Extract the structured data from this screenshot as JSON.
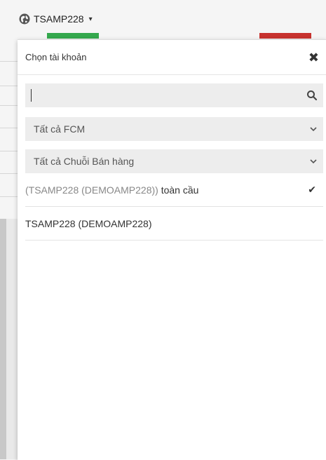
{
  "account_selector": {
    "label": "TSAMP228",
    "icon": "globe-icon",
    "caret": "▾"
  },
  "popover": {
    "title": "Chọn tài khoản",
    "close_glyph": "✖",
    "search": {
      "value": "",
      "placeholder": "",
      "icon": "search-icon"
    },
    "filters": {
      "fcm": "Tất cả FCM",
      "sales_chain": "Tất cả Chuỗi Bán hàng"
    },
    "accounts": [
      {
        "prefix": "(TSAMP228 (DEMOAMP228))",
        "suffix": " toàn cầu",
        "selected": true
      },
      {
        "prefix": "TSAMP228 (DEMOAMP228)",
        "suffix": "",
        "selected": false
      }
    ],
    "check_glyph": "✔"
  },
  "colors": {
    "green_bar": "#34a84d",
    "red_bar": "#c7322e",
    "field_bg": "#ededed"
  }
}
